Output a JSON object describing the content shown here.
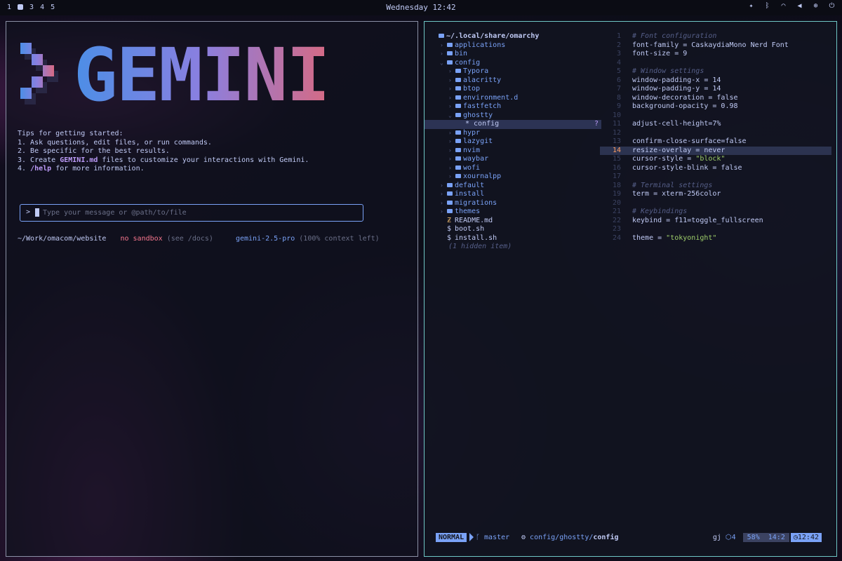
{
  "topbar": {
    "workspaces": [
      "1",
      "3",
      "4",
      "5"
    ],
    "clock": "Wednesday 12:42",
    "tray_icons": [
      "ai-icon",
      "bluetooth-icon",
      "wifi-icon",
      "volume-icon",
      "cpu-icon",
      "power-icon"
    ]
  },
  "gemini": {
    "logo": "GEMINI",
    "tips_title": "Tips for getting started:",
    "tip1": "1. Ask questions, edit files, or run commands.",
    "tip2": "2. Be specific for the best results.",
    "tip3_pre": "3. Create ",
    "tip3_bold": "GEMINI.md",
    "tip3_post": " files to customize your interactions with Gemini.",
    "tip4_pre": "4. ",
    "tip4_bold": "/help",
    "tip4_post": " for more information.",
    "prompt_symbol": ">",
    "prompt_placeholder": "Type your message or @path/to/file",
    "status_path": "~/Work/omacom/website",
    "status_sandbox": "no sandbox",
    "status_sandbox_hint": " (see /docs)",
    "status_model": "gemini-2.5-pro",
    "status_context": " (100% context left)"
  },
  "tree": {
    "root": "~/.local/share/omarchy",
    "items": [
      {
        "label": "applications"
      },
      {
        "label": "bin"
      },
      {
        "label": "config"
      },
      {
        "label": "Typora"
      },
      {
        "label": "alacritty"
      },
      {
        "label": "btop"
      },
      {
        "label": "environment.d"
      },
      {
        "label": "fastfetch"
      },
      {
        "label": "ghostty"
      },
      {
        "label": "* config",
        "badge": "?"
      },
      {
        "label": "hypr"
      },
      {
        "label": "lazygit"
      },
      {
        "label": "nvim"
      },
      {
        "label": "waybar"
      },
      {
        "label": "wofi"
      },
      {
        "label": "xournalpp"
      },
      {
        "label": "default"
      },
      {
        "label": "install"
      },
      {
        "label": "migrations"
      },
      {
        "label": "themes"
      },
      {
        "label": "README.md"
      },
      {
        "label": "boot.sh"
      },
      {
        "label": "install.sh"
      }
    ],
    "hidden_note": "(1 hidden item)"
  },
  "editor": {
    "lines": [
      {
        "n": "1",
        "text": "# Font configuration"
      },
      {
        "n": "2",
        "text": "font-family = CaskaydiaMono Nerd Font"
      },
      {
        "n": "3",
        "text": "font-size = 9"
      },
      {
        "n": "4",
        "text": ""
      },
      {
        "n": "5",
        "text": "# Window settings"
      },
      {
        "n": "6",
        "text": "window-padding-x = 14"
      },
      {
        "n": "7",
        "text": "window-padding-y = 14"
      },
      {
        "n": "8",
        "text": "window-decoration = false"
      },
      {
        "n": "9",
        "text": "background-opacity = 0.98"
      },
      {
        "n": "10",
        "text": ""
      },
      {
        "n": "11",
        "text": "adjust-cell-height=7%"
      },
      {
        "n": "12",
        "text": ""
      },
      {
        "n": "13",
        "text": "confirm-close-surface=false"
      },
      {
        "n": "14",
        "text": "resize-overlay = never"
      },
      {
        "n": "15",
        "pre": "cursor-style = ",
        "str": "\"block\""
      },
      {
        "n": "16",
        "text": "cursor-style-blink = false"
      },
      {
        "n": "17",
        "text": ""
      },
      {
        "n": "18",
        "text": "# Terminal settings"
      },
      {
        "n": "19",
        "text": "term = xterm-256color"
      },
      {
        "n": "20",
        "text": ""
      },
      {
        "n": "21",
        "text": "# Keybindings"
      },
      {
        "n": "22",
        "text": "keybind = f11=toggle_fullscreen"
      },
      {
        "n": "23",
        "text": ""
      },
      {
        "n": "24",
        "pre": "theme = ",
        "str": "\"tokyonight\""
      }
    ]
  },
  "statusline": {
    "mode": "NORMAL",
    "branch": "master",
    "path_dir": "config/ghostty/",
    "path_file": "config",
    "keys": "gj",
    "lsp": "4",
    "percent": "58%",
    "position": "14:2",
    "clock": "12:42"
  },
  "colors": {
    "accent_blue": "#7aa2f7",
    "accent_purple": "#bb9af7",
    "accent_red": "#f7768e",
    "string_green": "#9ece6a",
    "comment": "#565f89",
    "cursorline_nr": "#ff9e64"
  }
}
